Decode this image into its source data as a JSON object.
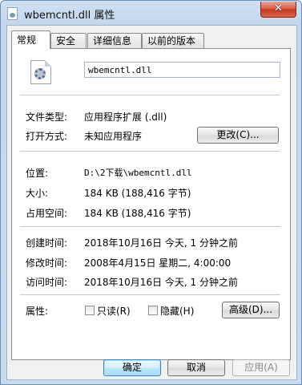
{
  "window": {
    "title": "wbemcntl.dll 属性",
    "close_glyph": "✕"
  },
  "tabs": [
    "常规",
    "安全",
    "详细信息",
    "以前的版本"
  ],
  "general": {
    "filename": "wbemcntl.dll",
    "type_label": "文件类型:",
    "type_value": "应用程序扩展 (.dll)",
    "opens_label": "打开方式:",
    "opens_value": "未知应用程序",
    "change_button": "更改(C)...",
    "location_label": "位置:",
    "location_value": "D:\\2下载\\wbemcntl.dll",
    "size_label": "大小:",
    "size_value": "184 KB (188,416 字节)",
    "size_on_disk_label": "占用空间:",
    "size_on_disk_value": "184 KB (188,416 字节)",
    "created_label": "创建时间:",
    "created_value": "2018年10月16日 今天, 1 分钟之前",
    "modified_label": "修改时间:",
    "modified_value": "2008年4月15日 星期二, 4:00:00",
    "accessed_label": "访问时间:",
    "accessed_value": "2018年10月16日 今天, 1 分钟之前",
    "attributes_label": "属性:",
    "readonly_label": "只读(R)",
    "readonly_checked": false,
    "hidden_label": "隐藏(H)",
    "hidden_checked": false,
    "advanced_button": "高级(D)..."
  },
  "footer": {
    "ok": "确定",
    "cancel": "取消",
    "apply": "应用(A)"
  },
  "icons": {
    "title_icon": "dll-file-icon",
    "file_icon": "dll-gear-file-icon"
  },
  "colors": {
    "frame": "#c8daee",
    "close": "#c2361f",
    "primary_button": "#bee6fd"
  }
}
